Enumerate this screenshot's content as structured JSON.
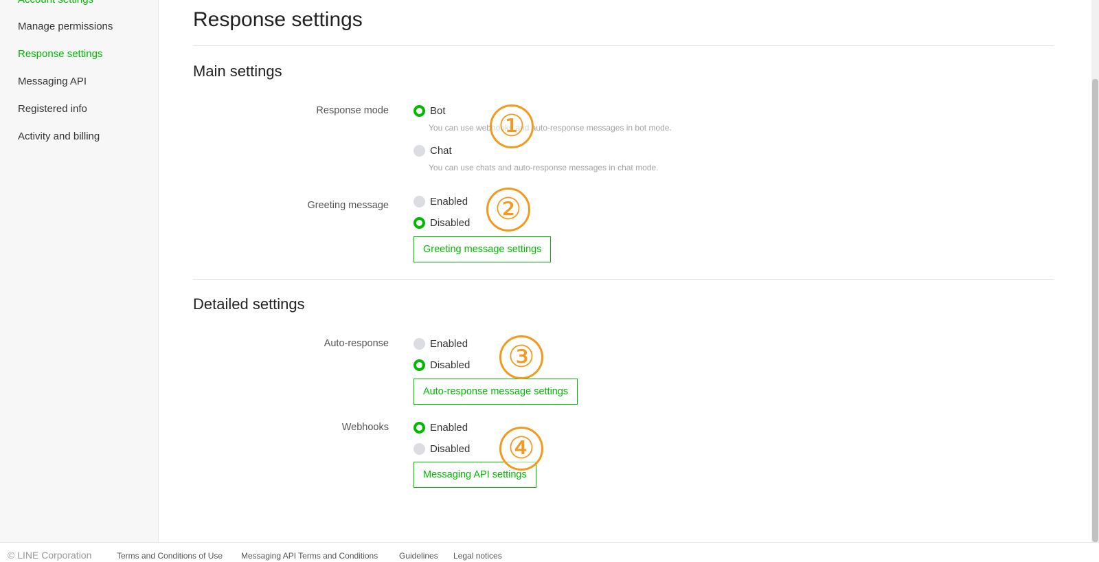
{
  "sidebar": {
    "items": [
      {
        "label": "Account settings"
      },
      {
        "label": "Manage permissions"
      },
      {
        "label": "Response settings"
      },
      {
        "label": "Messaging API"
      },
      {
        "label": "Registered info"
      },
      {
        "label": "Activity and billing"
      }
    ],
    "active_index": 2
  },
  "page": {
    "title": "Response settings"
  },
  "main_settings": {
    "title": "Main settings",
    "response_mode": {
      "label": "Response mode",
      "options": [
        {
          "label": "Bot",
          "selected": true,
          "hint": "You can use webhooks and auto-response messages in bot mode."
        },
        {
          "label": "Chat",
          "selected": false,
          "hint": "You can use chats and auto-response messages in chat mode."
        }
      ]
    },
    "greeting_message": {
      "label": "Greeting message",
      "options": [
        {
          "label": "Enabled",
          "selected": false
        },
        {
          "label": "Disabled",
          "selected": true
        }
      ],
      "button_label": "Greeting message settings"
    }
  },
  "detailed_settings": {
    "title": "Detailed settings",
    "auto_response": {
      "label": "Auto-response",
      "options": [
        {
          "label": "Enabled",
          "selected": false
        },
        {
          "label": "Disabled",
          "selected": true
        }
      ],
      "button_label": "Auto-response message settings"
    },
    "webhooks": {
      "label": "Webhooks",
      "options": [
        {
          "label": "Enabled",
          "selected": true
        },
        {
          "label": "Disabled",
          "selected": false
        }
      ],
      "button_label": "Messaging API settings"
    }
  },
  "callouts": [
    "①",
    "②",
    "③",
    "④"
  ],
  "footer": {
    "copyright": "© LINE Corporation",
    "links": [
      "Terms and Conditions of Use",
      "Messaging API Terms and Conditions",
      "Guidelines",
      "Legal notices"
    ]
  },
  "colors": {
    "accent": "#00b900",
    "callout": "#f39a1e",
    "radio_off": "#dcdde2"
  }
}
